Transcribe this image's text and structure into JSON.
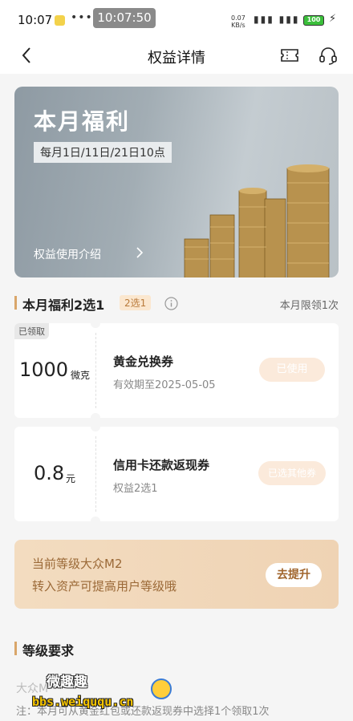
{
  "status_bar": {
    "time": "10:07",
    "center_clock": "10:07:50",
    "net_speed_value": "0.07",
    "net_speed_unit": "KB/s",
    "battery": "100"
  },
  "nav": {
    "title": "权益详情",
    "back_icon": "chevron-left-icon",
    "ticket_icon": "ticket-icon",
    "service_icon": "headset-icon"
  },
  "banner": {
    "title": "本月福利",
    "subtitle": "每月1日/11日/21日10点",
    "link": "权益使用介绍"
  },
  "section": {
    "title": "本月福利2选1",
    "tag": "2选1",
    "limit": "本月限领1次"
  },
  "coupons": [
    {
      "badge": "已领取",
      "amount": "1000",
      "unit": "微克",
      "name": "黄金兑换券",
      "desc": "有效期至2025-05-05",
      "button": "已使用"
    },
    {
      "amount": "0.8",
      "unit": "元",
      "name": "信用卡还款返现券",
      "desc": "权益2选1",
      "button": "已选其他券"
    }
  ],
  "promo": {
    "line1": "当前等级大众M2",
    "line2": "转入资产可提高用户等级哦",
    "button": "去提升"
  },
  "level": {
    "title": "等级要求",
    "line": "大众M",
    "note": "注：本月可从黄金红包或还款返现券中选择1个领取1次"
  },
  "watermark": {
    "cn": "微趣趣",
    "url": "bbs.weiququ.cn"
  },
  "colors": {
    "accent": "#d9a66a",
    "promo_text": "#9b6937",
    "tag_bg": "#fbe7cf"
  }
}
